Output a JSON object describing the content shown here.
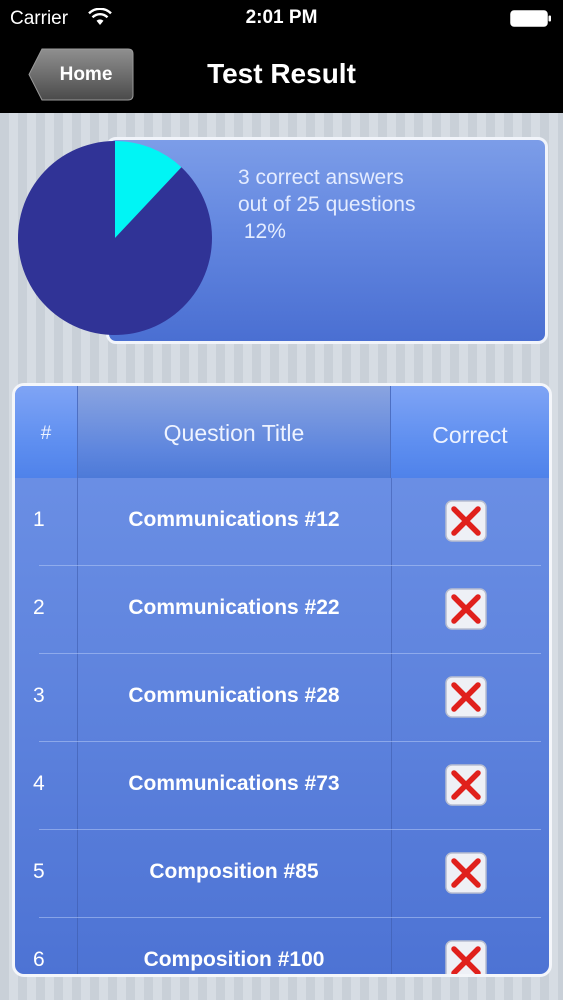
{
  "status_bar": {
    "carrier": "Carrier",
    "time": "2:01 PM"
  },
  "nav": {
    "back_label": "Home",
    "title": "Test Result"
  },
  "summary": {
    "correct": 3,
    "total": 25,
    "text": "3 correct answers\nout of 25 questions\n 12%"
  },
  "chart_data": {
    "type": "pie",
    "slices": [
      {
        "label": "correct",
        "value": 3,
        "color": "#00f5f5"
      },
      {
        "label": "incorrect",
        "value": 22,
        "color": "#303396"
      }
    ]
  },
  "table": {
    "headers": {
      "number": "#",
      "title": "Question Title",
      "correct": "Correct"
    },
    "rows": [
      {
        "number": "1",
        "title": "Communications #12",
        "correct": false
      },
      {
        "number": "2",
        "title": "Communications #22",
        "correct": false
      },
      {
        "number": "3",
        "title": "Communications #28",
        "correct": false
      },
      {
        "number": "4",
        "title": "Communications #73",
        "correct": false
      },
      {
        "number": "5",
        "title": "Composition #85",
        "correct": false
      },
      {
        "number": "6",
        "title": "Composition #100",
        "correct": false
      }
    ]
  },
  "colors": {
    "nav_background": "#000000",
    "incorrect_mark": "#e0201c"
  }
}
